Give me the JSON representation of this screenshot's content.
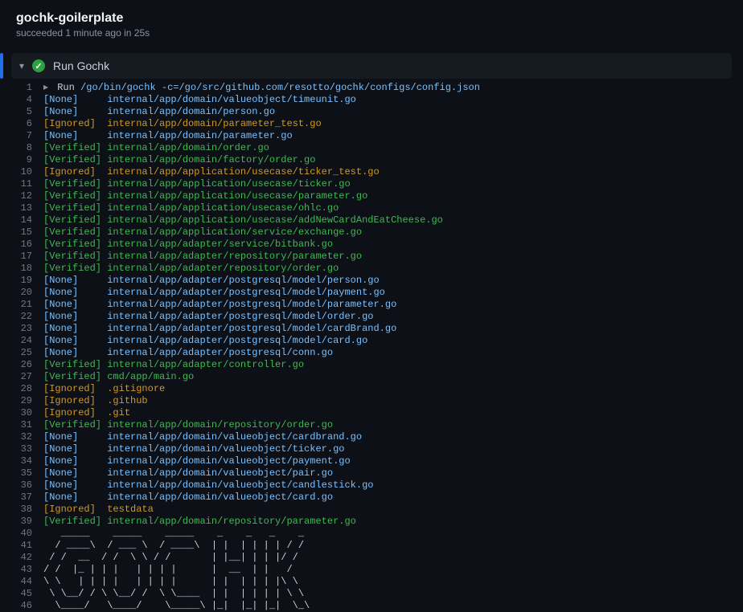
{
  "header": {
    "title": "gochk-goilerplate",
    "subtitle_prefix": "succeeded ",
    "subtitle_time": "1 minute ago",
    "subtitle_in": " in ",
    "subtitle_dur": "25s"
  },
  "step": {
    "name": "Run Gochk"
  },
  "run_cmd": {
    "prefix": "Run ",
    "cmd": "/go/bin/gochk -c=/go/src/github.com/resotto/gochk/configs/config.json"
  },
  "log": [
    {
      "n": 1,
      "type": "run"
    },
    {
      "n": 4,
      "status": "None",
      "path": "internal/app/domain/valueobject/timeunit.go"
    },
    {
      "n": 5,
      "status": "None",
      "path": "internal/app/domain/person.go"
    },
    {
      "n": 6,
      "status": "Ignored",
      "path": "internal/app/domain/parameter_test.go"
    },
    {
      "n": 7,
      "status": "None",
      "path": "internal/app/domain/parameter.go"
    },
    {
      "n": 8,
      "status": "Verified",
      "path": "internal/app/domain/order.go"
    },
    {
      "n": 9,
      "status": "Verified",
      "path": "internal/app/domain/factory/order.go"
    },
    {
      "n": 10,
      "status": "Ignored",
      "path": "internal/app/application/usecase/ticker_test.go"
    },
    {
      "n": 11,
      "status": "Verified",
      "path": "internal/app/application/usecase/ticker.go"
    },
    {
      "n": 12,
      "status": "Verified",
      "path": "internal/app/application/usecase/parameter.go"
    },
    {
      "n": 13,
      "status": "Verified",
      "path": "internal/app/application/usecase/ohlc.go"
    },
    {
      "n": 14,
      "status": "Verified",
      "path": "internal/app/application/usecase/addNewCardAndEatCheese.go"
    },
    {
      "n": 15,
      "status": "Verified",
      "path": "internal/app/application/service/exchange.go"
    },
    {
      "n": 16,
      "status": "Verified",
      "path": "internal/app/adapter/service/bitbank.go"
    },
    {
      "n": 17,
      "status": "Verified",
      "path": "internal/app/adapter/repository/parameter.go"
    },
    {
      "n": 18,
      "status": "Verified",
      "path": "internal/app/adapter/repository/order.go"
    },
    {
      "n": 19,
      "status": "None",
      "path": "internal/app/adapter/postgresql/model/person.go"
    },
    {
      "n": 20,
      "status": "None",
      "path": "internal/app/adapter/postgresql/model/payment.go"
    },
    {
      "n": 21,
      "status": "None",
      "path": "internal/app/adapter/postgresql/model/parameter.go"
    },
    {
      "n": 22,
      "status": "None",
      "path": "internal/app/adapter/postgresql/model/order.go"
    },
    {
      "n": 23,
      "status": "None",
      "path": "internal/app/adapter/postgresql/model/cardBrand.go"
    },
    {
      "n": 24,
      "status": "None",
      "path": "internal/app/adapter/postgresql/model/card.go"
    },
    {
      "n": 25,
      "status": "None",
      "path": "internal/app/adapter/postgresql/conn.go"
    },
    {
      "n": 26,
      "status": "Verified",
      "path": "internal/app/adapter/controller.go"
    },
    {
      "n": 27,
      "status": "Verified",
      "path": "cmd/app/main.go"
    },
    {
      "n": 28,
      "status": "Ignored",
      "path": ".gitignore"
    },
    {
      "n": 29,
      "status": "Ignored",
      "path": ".github"
    },
    {
      "n": 30,
      "status": "Ignored",
      "path": ".git"
    },
    {
      "n": 31,
      "status": "Verified",
      "path": "internal/app/domain/repository/order.go"
    },
    {
      "n": 32,
      "status": "None",
      "path": "internal/app/domain/valueobject/cardbrand.go"
    },
    {
      "n": 33,
      "status": "None",
      "path": "internal/app/domain/valueobject/ticker.go"
    },
    {
      "n": 34,
      "status": "None",
      "path": "internal/app/domain/valueobject/payment.go"
    },
    {
      "n": 35,
      "status": "None",
      "path": "internal/app/domain/valueobject/pair.go"
    },
    {
      "n": 36,
      "status": "None",
      "path": "internal/app/domain/valueobject/candlestick.go"
    },
    {
      "n": 37,
      "status": "None",
      "path": "internal/app/domain/valueobject/card.go"
    },
    {
      "n": 38,
      "status": "Ignored",
      "path": "testdata"
    },
    {
      "n": 39,
      "status": "Verified",
      "path": "internal/app/domain/repository/parameter.go"
    },
    {
      "n": 40,
      "ascii": "   _____    _____    _____    _    _   _    _"
    },
    {
      "n": 41,
      "ascii": "  / ____\\  / ___ \\  / ____\\  | |  | | | | / /"
    },
    {
      "n": 42,
      "ascii": " / /  __  / /  \\ \\ / /       | |__| | | |/ /"
    },
    {
      "n": 43,
      "ascii": "/ /  |_ | | |   | | | |      |  __  | |   /"
    },
    {
      "n": 44,
      "ascii": "\\ \\   | | | |   | | | |      | |  | | | |\\ \\"
    },
    {
      "n": 45,
      "ascii": " \\ \\__/ / \\ \\__/ /  \\ \\____  | |  | | | | \\ \\"
    },
    {
      "n": 46,
      "ascii": "  \\____/   \\____/    \\_____\\ |_|  |_| |_|  \\_\\"
    }
  ],
  "status_labels": {
    "None": "[None]    ",
    "Ignored": "[Ignored] ",
    "Verified": "[Verified]"
  }
}
